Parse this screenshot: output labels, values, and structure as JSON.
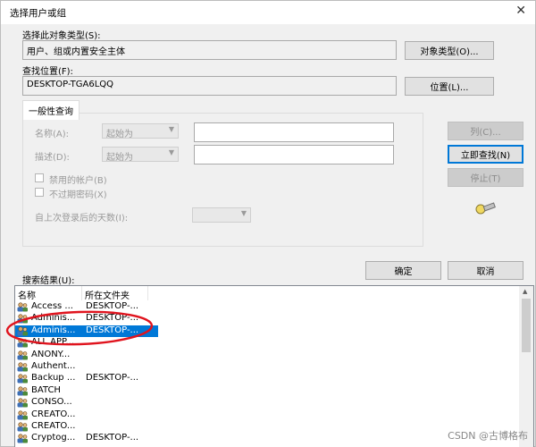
{
  "window": {
    "title": "选择用户或组",
    "close_glyph": "✕"
  },
  "object_type": {
    "label": "选择此对象类型(S):",
    "value": "用户、组或内置安全主体",
    "button": "对象类型(O)..."
  },
  "location": {
    "label": "查找位置(F):",
    "value": "DESKTOP-TGA6LQQ",
    "button": "位置(L)..."
  },
  "query": {
    "tab": "一般性查询",
    "name_label": "名称(A):",
    "name_mode": "起始为",
    "desc_label": "描述(D):",
    "desc_mode": "起始为",
    "disabled_accounts": "禁用的帐户(B)",
    "no_expire_pwd": "不过期密码(X)",
    "days_since_login": "自上次登录后的天数(I):",
    "btn_columns": "列(C)...",
    "btn_find_now": "立即查找(N)",
    "btn_stop": "停止(T)"
  },
  "footer": {
    "ok": "确定",
    "cancel": "取消"
  },
  "results": {
    "label": "搜索结果(U):",
    "columns": [
      "名称",
      "所在文件夹"
    ],
    "rows": [
      {
        "name": "Access ...",
        "folder": "DESKTOP-..."
      },
      {
        "name": "Adminis...",
        "folder": "DESKTOP-..."
      },
      {
        "name": "Adminis...",
        "folder": "DESKTOP-...",
        "selected": true
      },
      {
        "name": "ALL APP...",
        "folder": ""
      },
      {
        "name": "ANONY...",
        "folder": ""
      },
      {
        "name": "Authent...",
        "folder": ""
      },
      {
        "name": "Backup ...",
        "folder": "DESKTOP-..."
      },
      {
        "name": "BATCH",
        "folder": ""
      },
      {
        "name": "CONSO...",
        "folder": ""
      },
      {
        "name": "CREATO...",
        "folder": ""
      },
      {
        "name": "CREATO...",
        "folder": ""
      },
      {
        "name": "Cryptog...",
        "folder": "DESKTOP-..."
      }
    ]
  },
  "watermark": "CSDN @古博格布",
  "colors": {
    "selection": "#0078d7",
    "annotation": "#e0141e"
  }
}
